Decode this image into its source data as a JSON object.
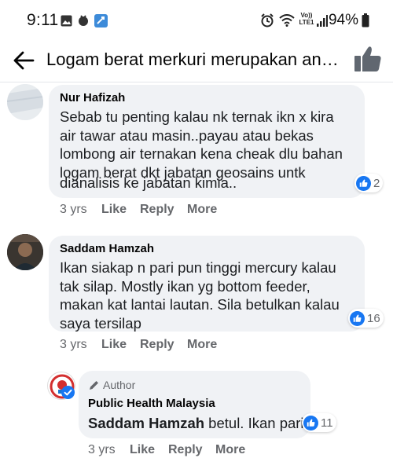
{
  "status_bar": {
    "time": "9:11",
    "battery": "94%",
    "volte_top": "Vo))",
    "volte_bottom": "LTE1",
    "icons": [
      "gallery-icon",
      "airdroid-icon",
      "app-icon",
      "alarm-icon",
      "wifi-icon",
      "volte-icon",
      "signal-icon",
      "battery-icon"
    ]
  },
  "header": {
    "title": "Logam berat merkuri merupakan ant..."
  },
  "comments": [
    {
      "author": "Nur Hafizah",
      "lines": [
        "Sebab tu penting kalau nk ternak ikn x kira",
        "air tawar atau masin..payau atau bekas",
        "lombong air ternakan kena cheak dlu bahan",
        "logam berat dkt jabatan geosains untk",
        "dianalisis ke jabatan kimia.."
      ],
      "reactions": "2",
      "time": "3 yrs",
      "like": "Like",
      "reply": "Reply",
      "more": "More"
    },
    {
      "author": "Saddam Hamzah",
      "lines": [
        "Ikan siakap n pari pun tinggi mercury kalau",
        "tak silap. Mostly ikan yg bottom feeder,",
        "makan kat lantai lautan. Sila betulkan kalau",
        "saya tersilap"
      ],
      "reactions": "16",
      "time": "3 yrs",
      "like": "Like",
      "reply": "Reply",
      "more": "More"
    }
  ],
  "reply": {
    "badge": "Author",
    "author": "Public Health Malaysia",
    "mention": "Saddam Hamzah",
    "text": " betul. Ikan pari",
    "reactions": "11",
    "time": "3 yrs",
    "like": "Like",
    "reply": "Reply",
    "more": "More"
  },
  "colors": {
    "bubble": "#f0f2f5",
    "like_blue": "#1877f2",
    "secondary_text": "#65676b"
  }
}
